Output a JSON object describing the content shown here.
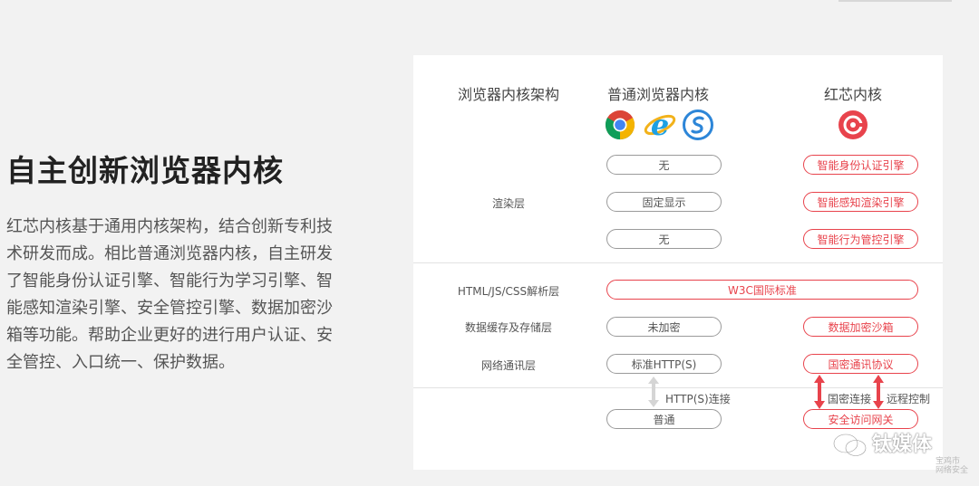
{
  "left": {
    "title": "自主创新浏览器内核",
    "description": "红芯内核基于通用内核架构，结合创新专利技术研发而成。相比普通浏览器内核，自主研发了智能身份认证引擎、智能行为学习引擎、智能感知渲染引擎、安全管控引擎、数据加密沙箱等功能。帮助企业更好的进行用户认证、安全管控、入口统一、保护数据。"
  },
  "diagram": {
    "headers": {
      "architecture": "浏览器内核架构",
      "normal": "普通浏览器内核",
      "redcore": "红芯内核"
    },
    "icons": [
      "chrome-icon",
      "ie-icon",
      "safari-like-icon",
      "redcore-logo-icon"
    ],
    "colors": {
      "accent": "#e8434c",
      "neutral": "#9a9a9a"
    },
    "layers": {
      "render": "渲染层",
      "parser": "HTML/JS/CSS解析层",
      "storage": "数据缓存及存储层",
      "network": "网络通讯层"
    },
    "normal_pills": {
      "r1": "无",
      "r2": "固定显示",
      "r3": "无",
      "storage": "未加密",
      "network": "标准HTTP(S)",
      "gateway": "普通"
    },
    "redcore_pills": {
      "r1": "智能身份认证引擎",
      "r2": "智能感知渲染引擎",
      "r3": "智能行为管控引擎",
      "storage": "数据加密沙箱",
      "network": "国密通讯协议",
      "gateway": "安全访问网关"
    },
    "shared_pill": "W3C国际标准",
    "notes": {
      "http": "HTTP(S)连接",
      "gm": "国密连接",
      "remote": "远程控制"
    }
  },
  "watermark": {
    "text": "钛媒体",
    "small1": "宝鸡市",
    "small2": "网络安全"
  }
}
